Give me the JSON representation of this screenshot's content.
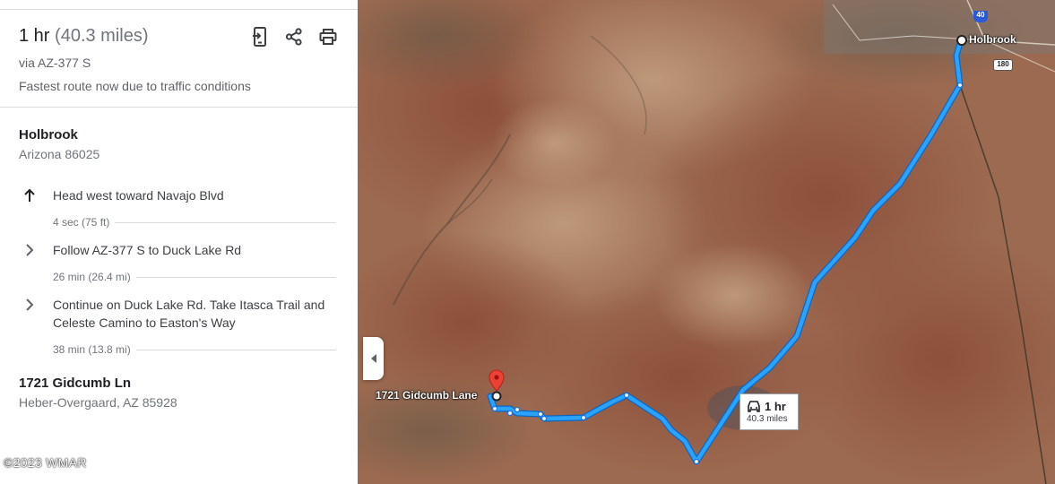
{
  "summary": {
    "duration": "1 hr",
    "distance": "(40.3 miles)",
    "via": "via AZ-377 S",
    "note": "Fastest route now due to traffic conditions"
  },
  "actions": [
    "send-to-phone-icon",
    "share-icon",
    "print-icon"
  ],
  "origin": {
    "name": "Holbrook",
    "address": "Arizona 86025"
  },
  "steps": [
    {
      "icon": "arrow-up-icon",
      "text": "Head west toward Navajo Blvd",
      "meta": "4 sec (75 ft)"
    },
    {
      "icon": "chevron-right-icon",
      "text": "Follow AZ-377 S to Duck Lake Rd",
      "meta": "26 min (26.4 mi)"
    },
    {
      "icon": "chevron-right-icon",
      "text": "Continue on Duck Lake Rd. Take Itasca Trail and Celeste Camino to Easton's Way",
      "meta": "38 min (13.8 mi)"
    }
  ],
  "destination": {
    "name": "1721 Gidcumb Ln",
    "address": "Heber-Overgaard, AZ 85928"
  },
  "watermark": "©2023 WMAR",
  "map": {
    "origin_label": "Holbrook",
    "destination_label": "1721 Gidcumb Lane",
    "route_time": "1 hr",
    "route_distance": "40.3 miles",
    "shield_i40": "40",
    "shield_us180": "180",
    "route_color": "#1a9af3",
    "marker_color": "#ea4335"
  }
}
